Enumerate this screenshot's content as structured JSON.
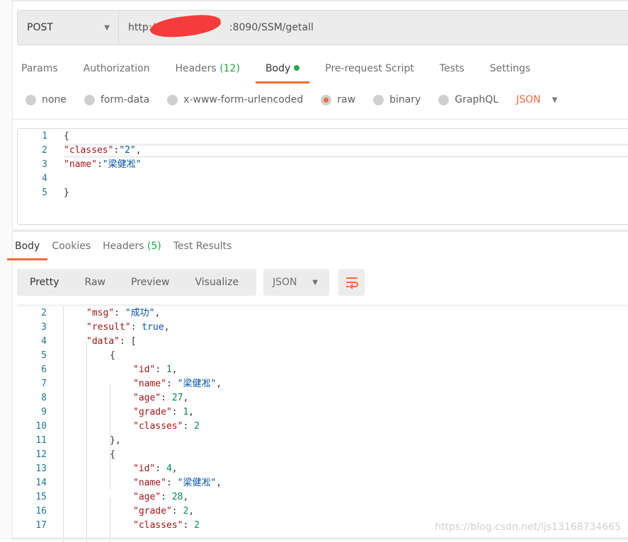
{
  "request": {
    "method": "POST",
    "url_prefix": "http://",
    "url_suffix": ":8090/SSM/getall"
  },
  "request_tabs": [
    {
      "label": "Params"
    },
    {
      "label": "Authorization"
    },
    {
      "label": "Headers",
      "count": "(12)"
    },
    {
      "label": "Body",
      "active": true
    },
    {
      "label": "Pre-request Script"
    },
    {
      "label": "Tests"
    },
    {
      "label": "Settings"
    }
  ],
  "body_types": [
    {
      "label": "none"
    },
    {
      "label": "form-data"
    },
    {
      "label": "x-www-form-urlencoded"
    },
    {
      "label": "raw",
      "selected": true
    },
    {
      "label": "binary"
    },
    {
      "label": "GraphQL"
    }
  ],
  "body_language": "JSON",
  "request_body": [
    {
      "num": "1",
      "indent": 0,
      "tokens": [
        [
          "p",
          "{"
        ]
      ]
    },
    {
      "num": "2",
      "indent": 0,
      "tokens": [
        [
          "k",
          "\"classes\""
        ],
        [
          "p",
          ":"
        ],
        [
          "s",
          "\"2\""
        ],
        [
          "p",
          ","
        ]
      ]
    },
    {
      "num": "3",
      "indent": 0,
      "tokens": [
        [
          "k",
          "\"name\""
        ],
        [
          "p",
          ":"
        ],
        [
          "s",
          "\"梁健凇\""
        ]
      ]
    },
    {
      "num": "4",
      "indent": 0,
      "tokens": []
    },
    {
      "num": "5",
      "indent": 0,
      "tokens": [
        [
          "p",
          "}"
        ]
      ]
    }
  ],
  "response_tabs": [
    {
      "label": "Body",
      "active": true
    },
    {
      "label": "Cookies"
    },
    {
      "label": "Headers",
      "count": "(5)"
    },
    {
      "label": "Test Results"
    }
  ],
  "view_modes": [
    {
      "label": "Pretty",
      "active": true
    },
    {
      "label": "Raw"
    },
    {
      "label": "Preview"
    },
    {
      "label": "Visualize"
    }
  ],
  "response_format": "JSON",
  "response_body": [
    {
      "num": "2",
      "indent": 1,
      "tokens": [
        [
          "k",
          "\"msg\""
        ],
        [
          "p",
          ": "
        ],
        [
          "s",
          "\"成功\""
        ],
        [
          "p",
          ","
        ]
      ]
    },
    {
      "num": "3",
      "indent": 1,
      "tokens": [
        [
          "k",
          "\"result\""
        ],
        [
          "p",
          ": "
        ],
        [
          "b",
          "true"
        ],
        [
          "p",
          ","
        ]
      ]
    },
    {
      "num": "4",
      "indent": 1,
      "tokens": [
        [
          "k",
          "\"data\""
        ],
        [
          "p",
          ": ["
        ]
      ]
    },
    {
      "num": "5",
      "indent": 2,
      "tokens": [
        [
          "p",
          "{"
        ]
      ]
    },
    {
      "num": "6",
      "indent": 3,
      "tokens": [
        [
          "k",
          "\"id\""
        ],
        [
          "p",
          ": "
        ],
        [
          "n",
          "1"
        ],
        [
          "p",
          ","
        ]
      ]
    },
    {
      "num": "7",
      "indent": 3,
      "tokens": [
        [
          "k",
          "\"name\""
        ],
        [
          "p",
          ": "
        ],
        [
          "s",
          "\"梁健凇\""
        ],
        [
          "p",
          ","
        ]
      ]
    },
    {
      "num": "8",
      "indent": 3,
      "tokens": [
        [
          "k",
          "\"age\""
        ],
        [
          "p",
          ": "
        ],
        [
          "n",
          "27"
        ],
        [
          "p",
          ","
        ]
      ]
    },
    {
      "num": "9",
      "indent": 3,
      "tokens": [
        [
          "k",
          "\"grade\""
        ],
        [
          "p",
          ": "
        ],
        [
          "n",
          "1"
        ],
        [
          "p",
          ","
        ]
      ]
    },
    {
      "num": "10",
      "indent": 3,
      "tokens": [
        [
          "k",
          "\"classes\""
        ],
        [
          "p",
          ": "
        ],
        [
          "n",
          "2"
        ]
      ]
    },
    {
      "num": "11",
      "indent": 2,
      "tokens": [
        [
          "p",
          "},"
        ]
      ]
    },
    {
      "num": "12",
      "indent": 2,
      "tokens": [
        [
          "p",
          "{"
        ]
      ]
    },
    {
      "num": "13",
      "indent": 3,
      "tokens": [
        [
          "k",
          "\"id\""
        ],
        [
          "p",
          ": "
        ],
        [
          "n",
          "4"
        ],
        [
          "p",
          ","
        ]
      ]
    },
    {
      "num": "14",
      "indent": 3,
      "tokens": [
        [
          "k",
          "\"name\""
        ],
        [
          "p",
          ": "
        ],
        [
          "s",
          "\"梁健凇\""
        ],
        [
          "p",
          ","
        ]
      ]
    },
    {
      "num": "15",
      "indent": 3,
      "tokens": [
        [
          "k",
          "\"age\""
        ],
        [
          "p",
          ": "
        ],
        [
          "n",
          "28"
        ],
        [
          "p",
          ","
        ]
      ]
    },
    {
      "num": "16",
      "indent": 3,
      "tokens": [
        [
          "k",
          "\"grade\""
        ],
        [
          "p",
          ": "
        ],
        [
          "n",
          "2"
        ],
        [
          "p",
          ","
        ]
      ]
    },
    {
      "num": "17",
      "indent": 3,
      "tokens": [
        [
          "k",
          "\"classes\""
        ],
        [
          "p",
          ": "
        ],
        [
          "n",
          "2"
        ]
      ]
    }
  ],
  "watermark": "https://blog.csdn.net/ljs13168734665",
  "colors": {
    "accent": "#f26b3a",
    "success": "#26a84a"
  }
}
